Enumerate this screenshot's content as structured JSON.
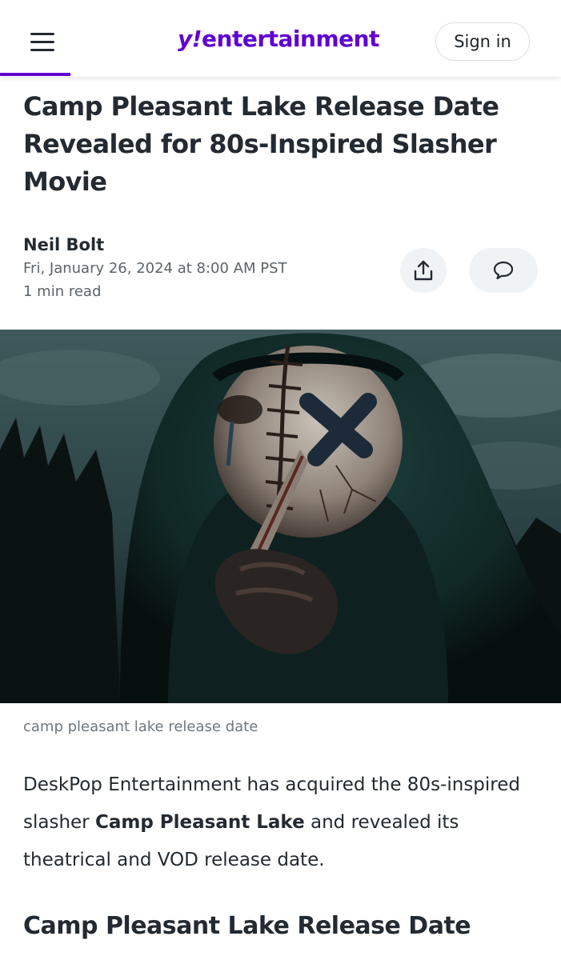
{
  "header": {
    "logo_mark": "y!",
    "logo_text": "entertainment",
    "signin_label": "Sign in",
    "brand_color": "#6001d2"
  },
  "article": {
    "headline": "Camp Pleasant Lake Release Date Revealed for 80s-Inspired Slasher Movie",
    "author": "Neil Bolt",
    "date": "Fri, January 26, 2024 at 8:00 AM PST",
    "read_time": "1 min read",
    "share_icon": "share-icon",
    "comment_icon": "comment-icon",
    "image_caption": "camp pleasant lake release date",
    "body": {
      "part1": "DeskPop Entertainment has acquired the 80s-inspired slasher ",
      "bold": "Camp Pleasant Lake",
      "part2": " and revealed its theatrical and VOD release date."
    },
    "subheading": "Camp Pleasant Lake Release Date"
  }
}
